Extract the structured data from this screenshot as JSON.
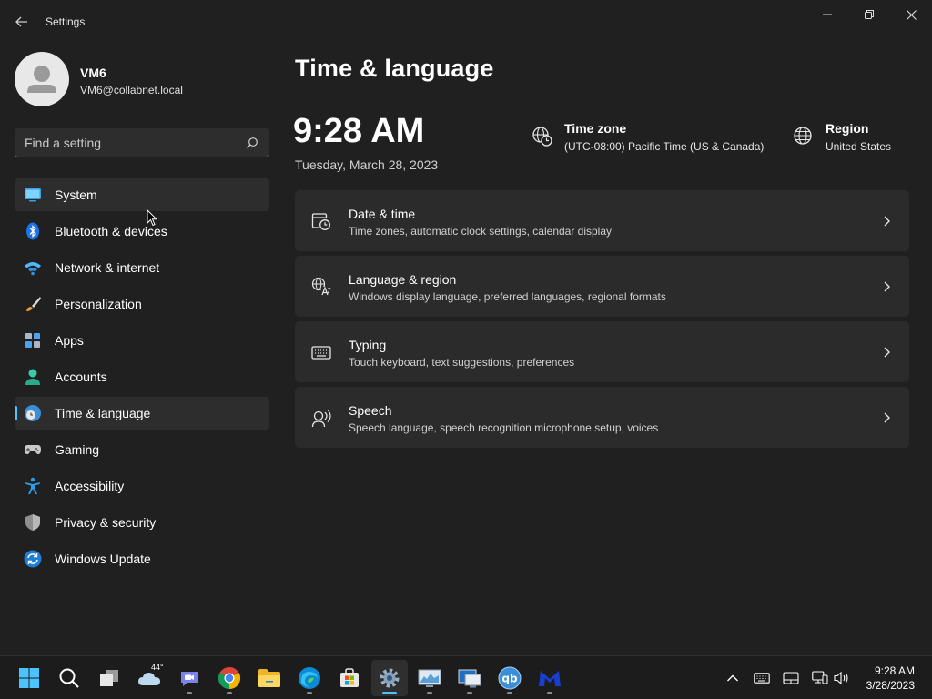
{
  "window": {
    "title": "Settings",
    "controls": [
      "minimize-icon",
      "restore-icon",
      "close-icon"
    ]
  },
  "profile": {
    "name": "VM6",
    "email": "VM6@collabnet.local"
  },
  "search": {
    "placeholder": "Find a setting",
    "value": ""
  },
  "sidebar": {
    "items": [
      {
        "label": "System",
        "icon": "system-icon"
      },
      {
        "label": "Bluetooth & devices",
        "icon": "bluetooth-icon"
      },
      {
        "label": "Network & internet",
        "icon": "wifi-icon"
      },
      {
        "label": "Personalization",
        "icon": "brush-icon"
      },
      {
        "label": "Apps",
        "icon": "apps-icon"
      },
      {
        "label": "Accounts",
        "icon": "person-icon"
      },
      {
        "label": "Time & language",
        "icon": "globe-clock-icon",
        "selected": true
      },
      {
        "label": "Gaming",
        "icon": "gamepad-icon"
      },
      {
        "label": "Accessibility",
        "icon": "accessibility-icon"
      },
      {
        "label": "Privacy & security",
        "icon": "shield-icon"
      },
      {
        "label": "Windows Update",
        "icon": "update-icon"
      }
    ]
  },
  "main": {
    "title": "Time & language",
    "time": "9:28 AM",
    "date": "Tuesday, March 28, 2023",
    "timezone": {
      "title": "Time zone",
      "value": "(UTC-08:00) Pacific Time (US & Canada)"
    },
    "region": {
      "title": "Region",
      "value": "United States"
    },
    "cards": [
      {
        "title": "Date & time",
        "desc": "Time zones, automatic clock settings, calendar display",
        "icon": "calendar-clock-icon"
      },
      {
        "title": "Language & region",
        "desc": "Windows display language, preferred languages, regional formats",
        "icon": "language-icon"
      },
      {
        "title": "Typing",
        "desc": "Touch keyboard, text suggestions, preferences",
        "icon": "keyboard-icon"
      },
      {
        "title": "Speech",
        "desc": "Speech language, speech recognition microphone setup, voices",
        "icon": "speech-icon"
      }
    ]
  },
  "taskbar": {
    "weather_temp": "44°",
    "apps": [
      "start",
      "search",
      "task-view",
      "weather",
      "teams-chat",
      "chrome",
      "file-explorer",
      "edge",
      "microsoft-store",
      "settings",
      "resource-monitor",
      "remote-desktop",
      "qbittorrent",
      "malwarebytes"
    ],
    "tray_time": "9:28 AM",
    "tray_date": "3/28/2023"
  },
  "colors": {
    "accent": "#4cc2ff",
    "background": "#202020",
    "card": "#2b2b2b"
  }
}
